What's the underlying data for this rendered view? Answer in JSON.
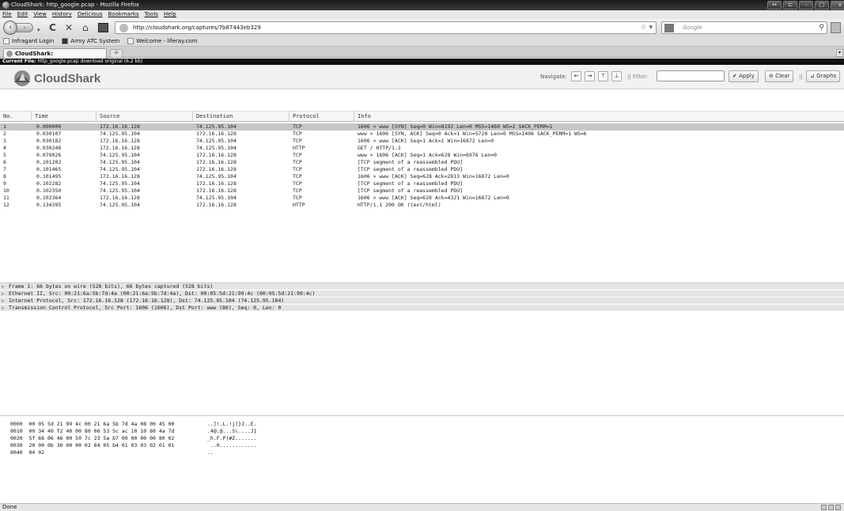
{
  "window": {
    "title": "CloudShark: http_google.pcap - Mozilla Firefox",
    "controls": [
      "↔",
      "⊏",
      "–",
      "□",
      "x"
    ]
  },
  "menu": [
    "File",
    "Edit",
    "View",
    "History",
    "Delicious",
    "Bookmarks",
    "Tools",
    "Help"
  ],
  "nav": {
    "back": "‹",
    "forward": "›",
    "reload": "C",
    "stop": "✕",
    "home": "⌂",
    "url": "http://cloudshark.org/captures/7b87443eb329",
    "search_placeholder": "Google",
    "bookmark_star": "☆ ▾"
  },
  "bookmarks": [
    {
      "label": "Infragard Login",
      "icon": "page-icon"
    },
    {
      "label": "Army ATC System",
      "icon": "army-icon"
    },
    {
      "label": "Welcome - liferay.com",
      "icon": "liferay-icon"
    }
  ],
  "tabs": [
    {
      "label": "CloudShark: http_google.pcap"
    }
  ],
  "newtab": "+",
  "current_file": {
    "label": "Current File:",
    "filename": "http_google.pcap",
    "download": "download",
    "original": "original (6.2 kb)"
  },
  "cloudshark": {
    "logo_text": "CloudShark",
    "navigate_label": "Navigate:",
    "nav_buttons": [
      "←",
      "→",
      "⊤",
      "⊥"
    ],
    "filter_label": "|| Filter:",
    "filter_value": "",
    "apply": "✔ Apply",
    "clear": "⊘ Clear",
    "separator": "||",
    "graphs": "⊿ Graphs"
  },
  "packet_list": {
    "columns": [
      "No.",
      "Time",
      "Source",
      "Destination",
      "Protocol",
      "Info"
    ],
    "selected_index": 0,
    "rows": [
      [
        "1",
        "0.000000",
        "172.16.16.128",
        "74.125.95.104",
        "TCP",
        "1606 > www [SYN] Seq=0 Win=8192 Len=0 MSS=1460 WS=2 SACK_PERM=1"
      ],
      [
        "2",
        "0.030107",
        "74.125.95.104",
        "172.16.16.128",
        "TCP",
        "www > 1606 [SYN, ACK] Seq=0 Ack=1 Win=5720 Len=0 MSS=1406 SACK_PERM=1 WS=6"
      ],
      [
        "3",
        "0.030182",
        "172.16.16.128",
        "74.125.95.104",
        "TCP",
        "1606 > www [ACK] Seq=1 Ack=1 Win=16872 Len=0"
      ],
      [
        "4",
        "0.030248",
        "172.16.16.128",
        "74.125.95.104",
        "HTTP",
        "GET / HTTP/1.1"
      ],
      [
        "5",
        "0.079026",
        "74.125.95.104",
        "172.16.16.128",
        "TCP",
        "www > 1606 [ACK] Seq=1 Ack=628 Win=6976 Len=0"
      ],
      [
        "6",
        "0.101202",
        "74.125.95.104",
        "172.16.16.128",
        "TCP",
        "[TCP segment of a reassembled PDU]"
      ],
      [
        "7",
        "0.101465",
        "74.125.95.104",
        "172.16.16.128",
        "TCP",
        "[TCP segment of a reassembled PDU]"
      ],
      [
        "8",
        "0.101495",
        "172.16.16.128",
        "74.125.95.104",
        "TCP",
        "1606 > www [ACK] Seq=628 Ack=2813 Win=16872 Len=0"
      ],
      [
        "9",
        "0.102282",
        "74.125.95.104",
        "172.16.16.128",
        "TCP",
        "[TCP segment of a reassembled PDU]"
      ],
      [
        "10",
        "0.102350",
        "74.125.95.104",
        "172.16.16.128",
        "TCP",
        "[TCP segment of a reassembled PDU]"
      ],
      [
        "11",
        "0.102364",
        "172.16.16.128",
        "74.125.95.104",
        "TCP",
        "1606 > www [ACK] Seq=628 Ack=4321 Win=16872 Len=0"
      ],
      [
        "12",
        "0.134395",
        "74.125.95.104",
        "172.16.16.128",
        "HTTP",
        "HTTP/1.1 200 OK (text/html)"
      ]
    ]
  },
  "details": [
    "Frame 1: 66 bytes on wire (528 bits), 66 bytes captured (528 bits)",
    "Ethernet II, Src: 00:21:6a:5b:7d:4a (00:21:6a:5b:7d:4a), Dst: 00:05:5d:21:99:4c (00:05:5d:21:99:4c)",
    "Internet Protocol, Src: 172.16.16.128 (172.16.16.128), Dst: 74.125.95.104 (74.125.95.104)",
    "Transmission Control Protocol, Src Port: 1606 (1606), Dst Port: www (80), Seq: 0, Len: 0"
  ],
  "hex": [
    {
      "hex": "0000  00 05 5d 21 99 4c 00 21 6a 5b 7d 4a 08 00 45 00",
      "ascii": "..]!.L.!j[}J..E."
    },
    {
      "hex": "0010  00 34 40 f2 40 00 80 06 53 5c ac 10 10 80 4a 7d",
      "ascii": ".4@.@...S\\....J}"
    },
    {
      "hex": "0020  5f 68 06 46 00 50 7c 23 5a b7 00 00 00 00 80 02",
      "ascii": "_h.F.P|#Z......."
    },
    {
      "hex": "0030  20 00 0b 30 00 00 02 04 05 b4 01 03 03 02 01 01",
      "ascii": " ..0............"
    },
    {
      "hex": "0040  04 02",
      "ascii": ".."
    }
  ],
  "status": {
    "text": "Done"
  }
}
